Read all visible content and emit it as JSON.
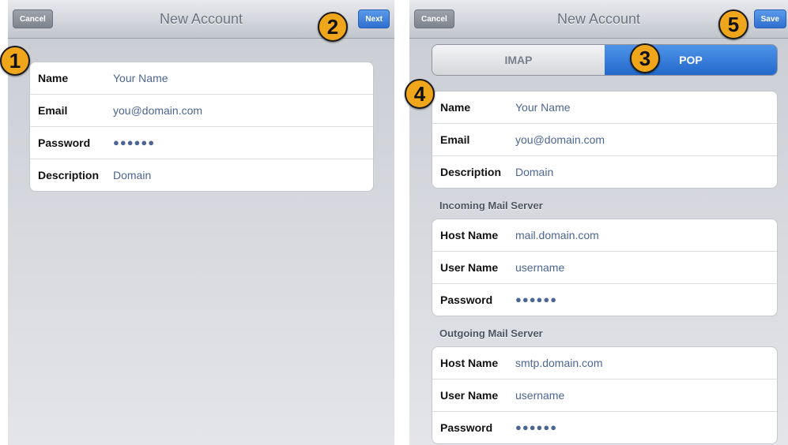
{
  "left": {
    "title": "New Account",
    "cancel_label": "Cancel",
    "next_label": "Next",
    "rows": [
      {
        "label": "Name",
        "value": "Your Name"
      },
      {
        "label": "Email",
        "value": "you@domain.com"
      },
      {
        "label": "Password",
        "value": "●●●●●●"
      },
      {
        "label": "Description",
        "value": "Domain"
      }
    ]
  },
  "right": {
    "title": "New Account",
    "cancel_label": "Cancel",
    "save_label": "Save",
    "segments": {
      "imap": "IMAP",
      "pop": "POP",
      "selected": "POP"
    },
    "account_rows": [
      {
        "label": "Name",
        "value": "Your Name"
      },
      {
        "label": "Email",
        "value": "you@domain.com"
      },
      {
        "label": "Description",
        "value": "Domain"
      }
    ],
    "incoming": {
      "header": "Incoming Mail Server",
      "rows": [
        {
          "label": "Host Name",
          "value": "mail.domain.com"
        },
        {
          "label": "User Name",
          "value": "username"
        },
        {
          "label": "Password",
          "value": "●●●●●●"
        }
      ]
    },
    "outgoing": {
      "header": "Outgoing Mail Server",
      "rows": [
        {
          "label": "Host Name",
          "value": "smtp.domain.com"
        },
        {
          "label": "User Name",
          "value": "username"
        },
        {
          "label": "Password",
          "value": "●●●●●●"
        }
      ]
    }
  },
  "badges": [
    "1",
    "2",
    "3",
    "4",
    "5"
  ],
  "colors": {
    "accent_blue": "#2f6fd0",
    "badge": "#f0a61b",
    "value_text": "#4d6593"
  }
}
